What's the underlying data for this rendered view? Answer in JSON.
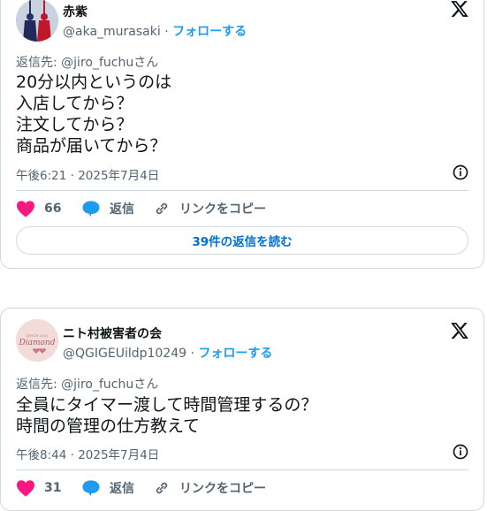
{
  "tweets": [
    {
      "display_name": "赤紫",
      "handle": "@aka_murasaki",
      "separator": " · ",
      "follow_label": "フォローする",
      "reply_to_prefix": "返信先: ",
      "reply_to_handle": "@jiro_fuchu",
      "reply_to_suffix": "さん",
      "lines": [
        "20分以内というのは",
        "入店してから？",
        "注文してから？",
        "商品が届いてから？"
      ],
      "timestamp": "午後6:21 · 2025年7月4日",
      "likes": "66",
      "reply_label": "返信",
      "copy_link_label": "リンクをコピー",
      "read_replies_label": "39件の返信を読む"
    },
    {
      "display_name": "ニト村被害者の会",
      "handle": "@QGIGEUildp10249",
      "separator": " · ",
      "follow_label": "フォローする",
      "reply_to_prefix": "返信先: ",
      "reply_to_handle": "@jiro_fuchu",
      "reply_to_suffix": "さん",
      "lines": [
        "全員にタイマー渡して時間管理するの？",
        "時間の管理の仕方教えて"
      ],
      "timestamp": "午後8:44 · 2025年7月4日",
      "likes": "31",
      "reply_label": "返信",
      "copy_link_label": "リンクをコピー",
      "avatar_text": "Diamond"
    }
  ],
  "colors": {
    "heart": "#f91880",
    "bubble": "#1d9bf0",
    "link": "#1d9bf0",
    "muted": "#536471",
    "border": "#cfd9de"
  },
  "icons": [
    "x-logo-icon",
    "info-icon",
    "heart-icon",
    "reply-bubble-icon",
    "link-icon"
  ]
}
